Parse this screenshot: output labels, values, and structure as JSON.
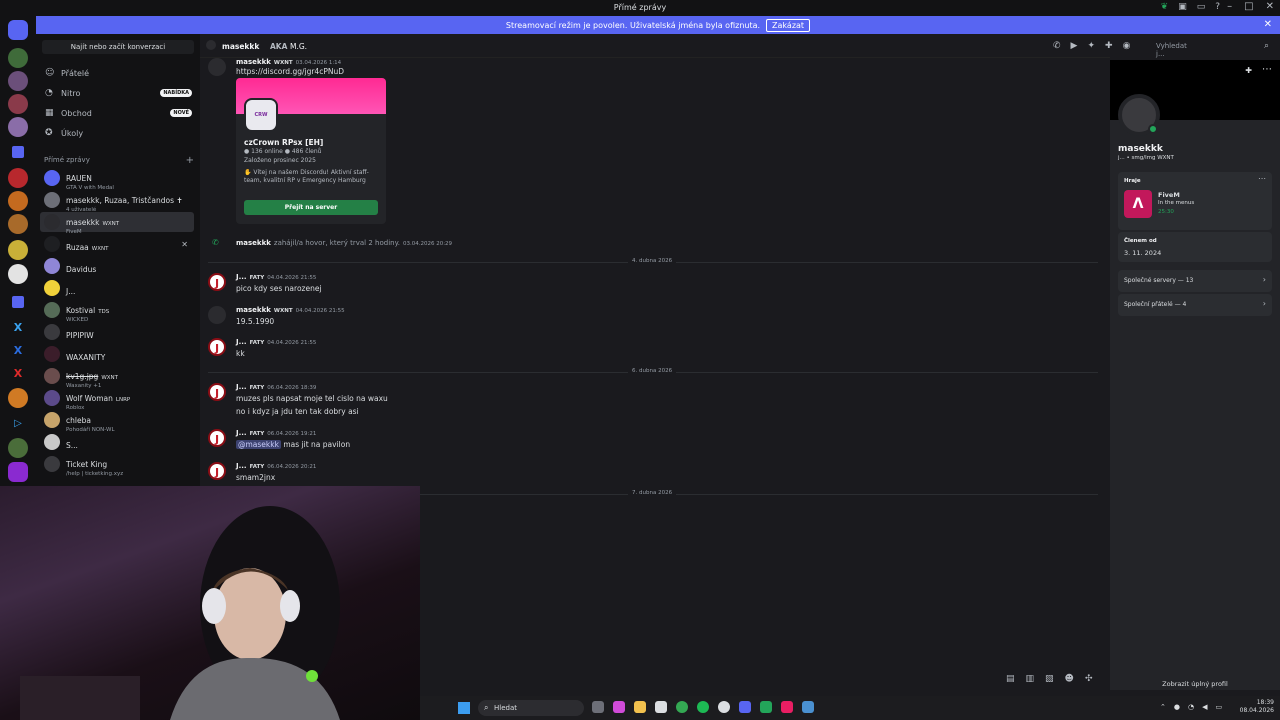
{
  "titlebar": {
    "title": "Přímé zprávy"
  },
  "banner": {
    "text": "Streamovací režim je povolen. Uživatelská jména byla ofiznuta.",
    "button": "Zakázat"
  },
  "dmlist": {
    "search": "Najít nebo začít konverzaci",
    "nav": [
      {
        "label": "Přátelé",
        "icon": "friends-icon"
      },
      {
        "label": "Nitro",
        "icon": "nitro-icon",
        "badge": "NABÍDKA"
      },
      {
        "label": "Obchod",
        "icon": "shop-icon",
        "badge": "NOVÉ"
      },
      {
        "label": "Úkoly",
        "icon": "quests-icon"
      }
    ],
    "header": "Přímé zprávy",
    "items": [
      {
        "name": "RAUEN",
        "sub": "GTA V with Medal",
        "color": "#5865f2"
      },
      {
        "name": "masekkk, Ruzaa, Tristčandos ✝",
        "sub": "4 uživatelé",
        "color": "#6d6f78"
      },
      {
        "name": "masekkk",
        "tag": "WXNT",
        "sub": "FiveM",
        "color": "#2b2b2f"
      },
      {
        "name": "Ruzaa",
        "tag": "WXNT",
        "sub": "",
        "color": "#1e1f22"
      },
      {
        "name": "Davidus",
        "sub": "",
        "color": "#8f86d6"
      },
      {
        "name": "J...",
        "sub": "",
        "color": "#f0d13a"
      },
      {
        "name": "Kostival",
        "tag": "TDS",
        "sub": "WICKED",
        "color": "#556b57"
      },
      {
        "name": "PIPIPIW",
        "sub": "",
        "color": "#3a3a3e"
      },
      {
        "name": "WAXANITY",
        "sub": "",
        "color": "#3b1d2a"
      },
      {
        "name": "kv1g.jpg",
        "tag": "WXNT",
        "sub": "Waxanity +1",
        "color": "#6a4d4d"
      },
      {
        "name": "Wolf Woman",
        "tag": "LNRP",
        "sub": "Roblox",
        "color": "#5b4a8a"
      },
      {
        "name": "chleba",
        "sub": "Pohodáři NON-WL",
        "color": "#c6a36a"
      },
      {
        "name": "S...",
        "sub": "",
        "color": "#c8c8c8"
      },
      {
        "name": "Ticket King",
        "sub": "/help | ticketking.xyz",
        "color": "#3a3a3e"
      }
    ]
  },
  "chat": {
    "header": {
      "name": "masekkk",
      "aka": "AKA",
      "aka_value": "M.G.",
      "search": "Vyhledat j..."
    },
    "invite": {
      "author": "masekkk",
      "tag": "WXNT",
      "time": "03.04.2026 1:14",
      "link": "https://discord.gg/jgr4cPNuD",
      "server": "czCrown RPsx [EH]",
      "stats": "● 136 online  ● 486 členů",
      "founded": "Založeno prosinec 2025",
      "desc": "✋ Vítej na našem Discordu! Aktivní staff-team, kvalitní RP v Emergency Hamburg",
      "button": "Přejít na server",
      "icon_text": "CRW"
    },
    "call": {
      "name": "masekkk",
      "text": "zahájil/a hovor, který trval 2 hodiny.",
      "time": "03.04.2026 20:29"
    },
    "separators": [
      "4. dubna 2026",
      "6. dubna 2026",
      "7. dubna 2026"
    ],
    "messages": [
      {
        "author": "J...",
        "tag": "FATY",
        "time": "04.04.2026 21:55",
        "lines": [
          "pico kdy ses narozenej"
        ]
      },
      {
        "author": "masekkk",
        "tag": "WXNT",
        "time": "04.04.2026 21:55",
        "lines": [
          "19.5.1990"
        ]
      },
      {
        "author": "J...",
        "tag": "FATY",
        "time": "04.04.2026 21:55",
        "lines": [
          "kk"
        ]
      },
      {
        "author": "J...",
        "tag": "FATY",
        "time": "06.04.2026 18:39",
        "lines": [
          "muzes pls napsat moje tel cislo na waxu",
          "no i kdyz ja jdu ten tak dobry asi"
        ]
      },
      {
        "author": "J...",
        "tag": "FATY",
        "time": "06.04.2026 19:21",
        "mention": "@masekkk",
        "lines": [
          "mas jit na pavilon"
        ]
      },
      {
        "author": "J...",
        "tag": "FATY",
        "time": "06.04.2026 20:21",
        "lines": [
          "smam2jnx"
        ]
      }
    ]
  },
  "profile": {
    "name": "masekkk",
    "handle": "j... • smg/lmg",
    "tag": "WXNT",
    "playing_label": "Hraje",
    "game": "FiveM",
    "game_state": "In the menus",
    "game_time": "25:30",
    "member_label": "Členem od",
    "member_since": "3. 11. 2024",
    "mutual_servers": "Společné servery — 13",
    "mutual_friends": "Společní přátelé — 4",
    "full_profile": "Zobrazit úplný profil"
  },
  "taskbar": {
    "search": "Hledat",
    "time": "18:39",
    "date": "08.04.2026"
  },
  "colors": {
    "accent": "#5865f2",
    "online": "#23a55a",
    "join": "#248046"
  }
}
